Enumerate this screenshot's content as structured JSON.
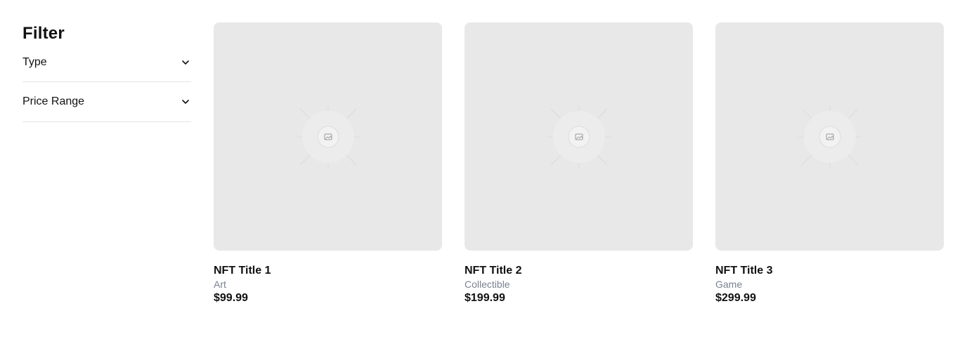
{
  "sidebar": {
    "title": "Filter",
    "filters": [
      {
        "label": "Type",
        "icon": "chevron-down-icon"
      },
      {
        "label": "Price Range",
        "icon": "chevron-down-icon"
      }
    ]
  },
  "products": [
    {
      "title": "NFT Title 1",
      "type": "Art",
      "price": "$99.99",
      "image_icon": "image-placeholder-icon"
    },
    {
      "title": "NFT Title 2",
      "type": "Collectible",
      "price": "$199.99",
      "image_icon": "image-placeholder-icon"
    },
    {
      "title": "NFT Title 3",
      "type": "Game",
      "price": "$299.99",
      "image_icon": "image-placeholder-icon"
    }
  ],
  "colors": {
    "placeholder_bg": "#e8e8e8",
    "muted_text": "#7a8290",
    "divider": "#e3e3e3"
  }
}
